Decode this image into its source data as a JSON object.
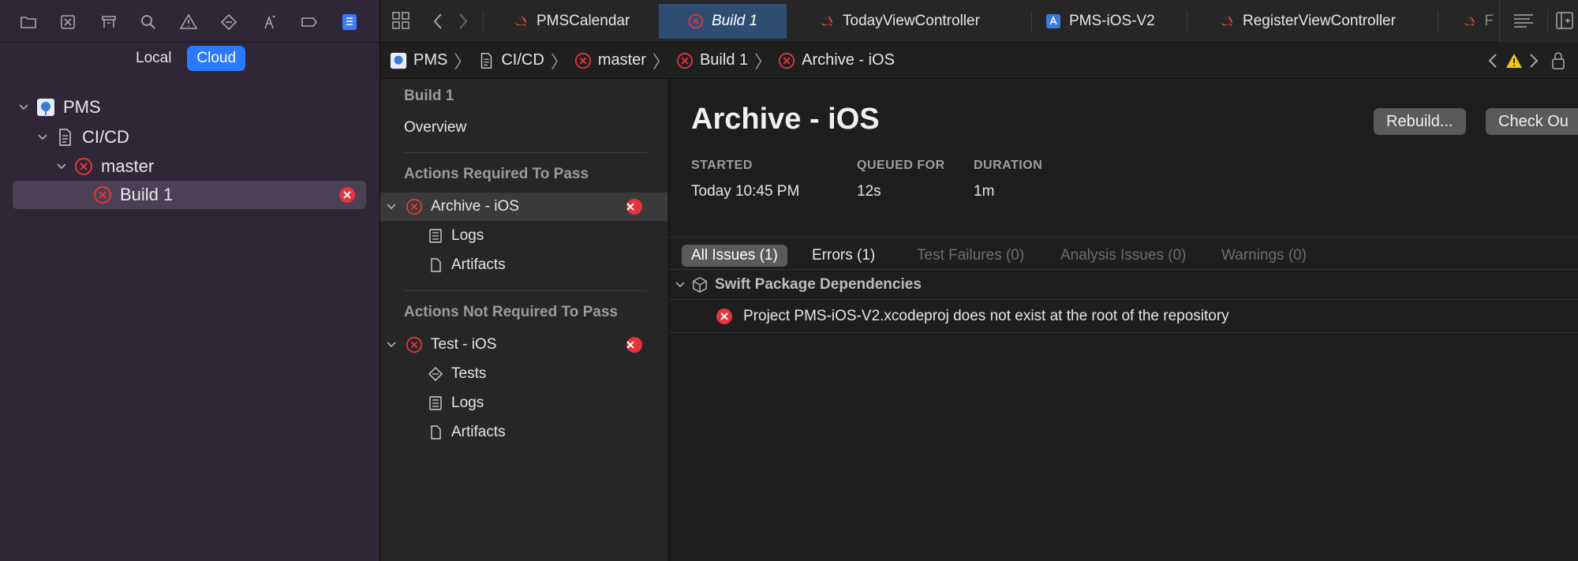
{
  "navigator": {
    "toolbar_icons": [
      "folder-icon",
      "source-control-icon",
      "symbols-icon",
      "search-icon",
      "warning-icon",
      "test-icon",
      "debug-icon",
      "breakpoint-icon",
      "report-icon"
    ],
    "segment": {
      "local": "Local",
      "cloud": "Cloud",
      "selected": "Cloud"
    },
    "tree": {
      "project": "PMS",
      "group": "CI/CD",
      "branch": "master",
      "build": "Build 1"
    }
  },
  "tabs": [
    {
      "label": "PMSCalendar",
      "icon": "swift-icon"
    },
    {
      "label": "Build 1",
      "icon": "error-icon"
    },
    {
      "label": "TodayViewController",
      "icon": "swift-icon"
    },
    {
      "label": "PMS-iOS-V2",
      "icon": "app-icon"
    },
    {
      "label": "RegisterViewController",
      "icon": "swift-icon"
    },
    {
      "label": "F",
      "icon": "swift-icon"
    }
  ],
  "path": [
    "PMS",
    "CI/CD",
    "master",
    "Build 1",
    "Archive - iOS"
  ],
  "outline": {
    "build_title": "Build 1",
    "overview": "Overview",
    "required_header": "Actions Required To Pass",
    "required_action": "Archive - iOS",
    "required_children": [
      "Logs",
      "Artifacts"
    ],
    "not_required_header": "Actions Not Required To Pass",
    "not_required_action": "Test - iOS",
    "not_required_children": [
      "Tests",
      "Logs",
      "Artifacts"
    ]
  },
  "detail": {
    "title": "Archive - iOS",
    "rebuild_label": "Rebuild...",
    "checkout_label": "Check Ou",
    "started_label": "STARTED",
    "started_value": "Today 10:45 PM",
    "queued_label": "QUEUED FOR",
    "queued_value": "12s",
    "duration_label": "DURATION",
    "duration_value": "1m",
    "filters": [
      "All Issues (1)",
      "Errors (1)",
      "Test Failures (0)",
      "Analysis Issues (0)",
      "Warnings (0)"
    ],
    "group": "Swift Package Dependencies",
    "issue": "Project PMS-iOS-V2.xcodeproj does not exist at the root of the repository"
  },
  "colors": {
    "accent": "#2a7aff",
    "error": "#e5343b",
    "selected_tab": "#2f4d73",
    "navigator_bg": "#2f2637"
  }
}
